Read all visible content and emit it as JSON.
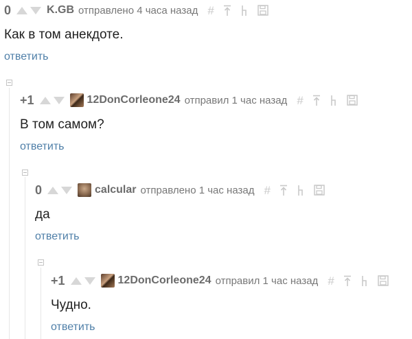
{
  "comments": [
    {
      "score": "0",
      "author": "K.GB",
      "meta": "отправлено 4 часа назад",
      "text": "Как в том анекдоте.",
      "reply": "ответить",
      "has_avatar": false
    },
    {
      "score": "+1",
      "author": "12DonCorleone24",
      "meta": "отправил 1 час назад",
      "text": "В том самом?",
      "reply": "ответить",
      "has_avatar": true
    },
    {
      "score": "0",
      "author": "calcular",
      "meta": "отправлено 1 час назад",
      "text": "да",
      "reply": "ответить",
      "has_avatar": true
    },
    {
      "score": "+1",
      "author": "12DonCorleone24",
      "meta": "отправил 1 час назад",
      "text": "Чудно.",
      "reply": "ответить",
      "has_avatar": true
    }
  ],
  "icons": {
    "link": "hash-icon",
    "parent": "arrow-to-top-icon",
    "branch": "branch-icon",
    "save": "floppy-save-icon",
    "upvote": "triangle-up-icon",
    "downvote": "triangle-down-icon",
    "collapse": "collapse-minus-icon"
  },
  "colors": {
    "reply_link": "#4f7fa8",
    "score": "#6e6e6e",
    "meta": "#777777",
    "icon": "#c9c9c9",
    "vote_arrow": "#d7d7d7"
  }
}
